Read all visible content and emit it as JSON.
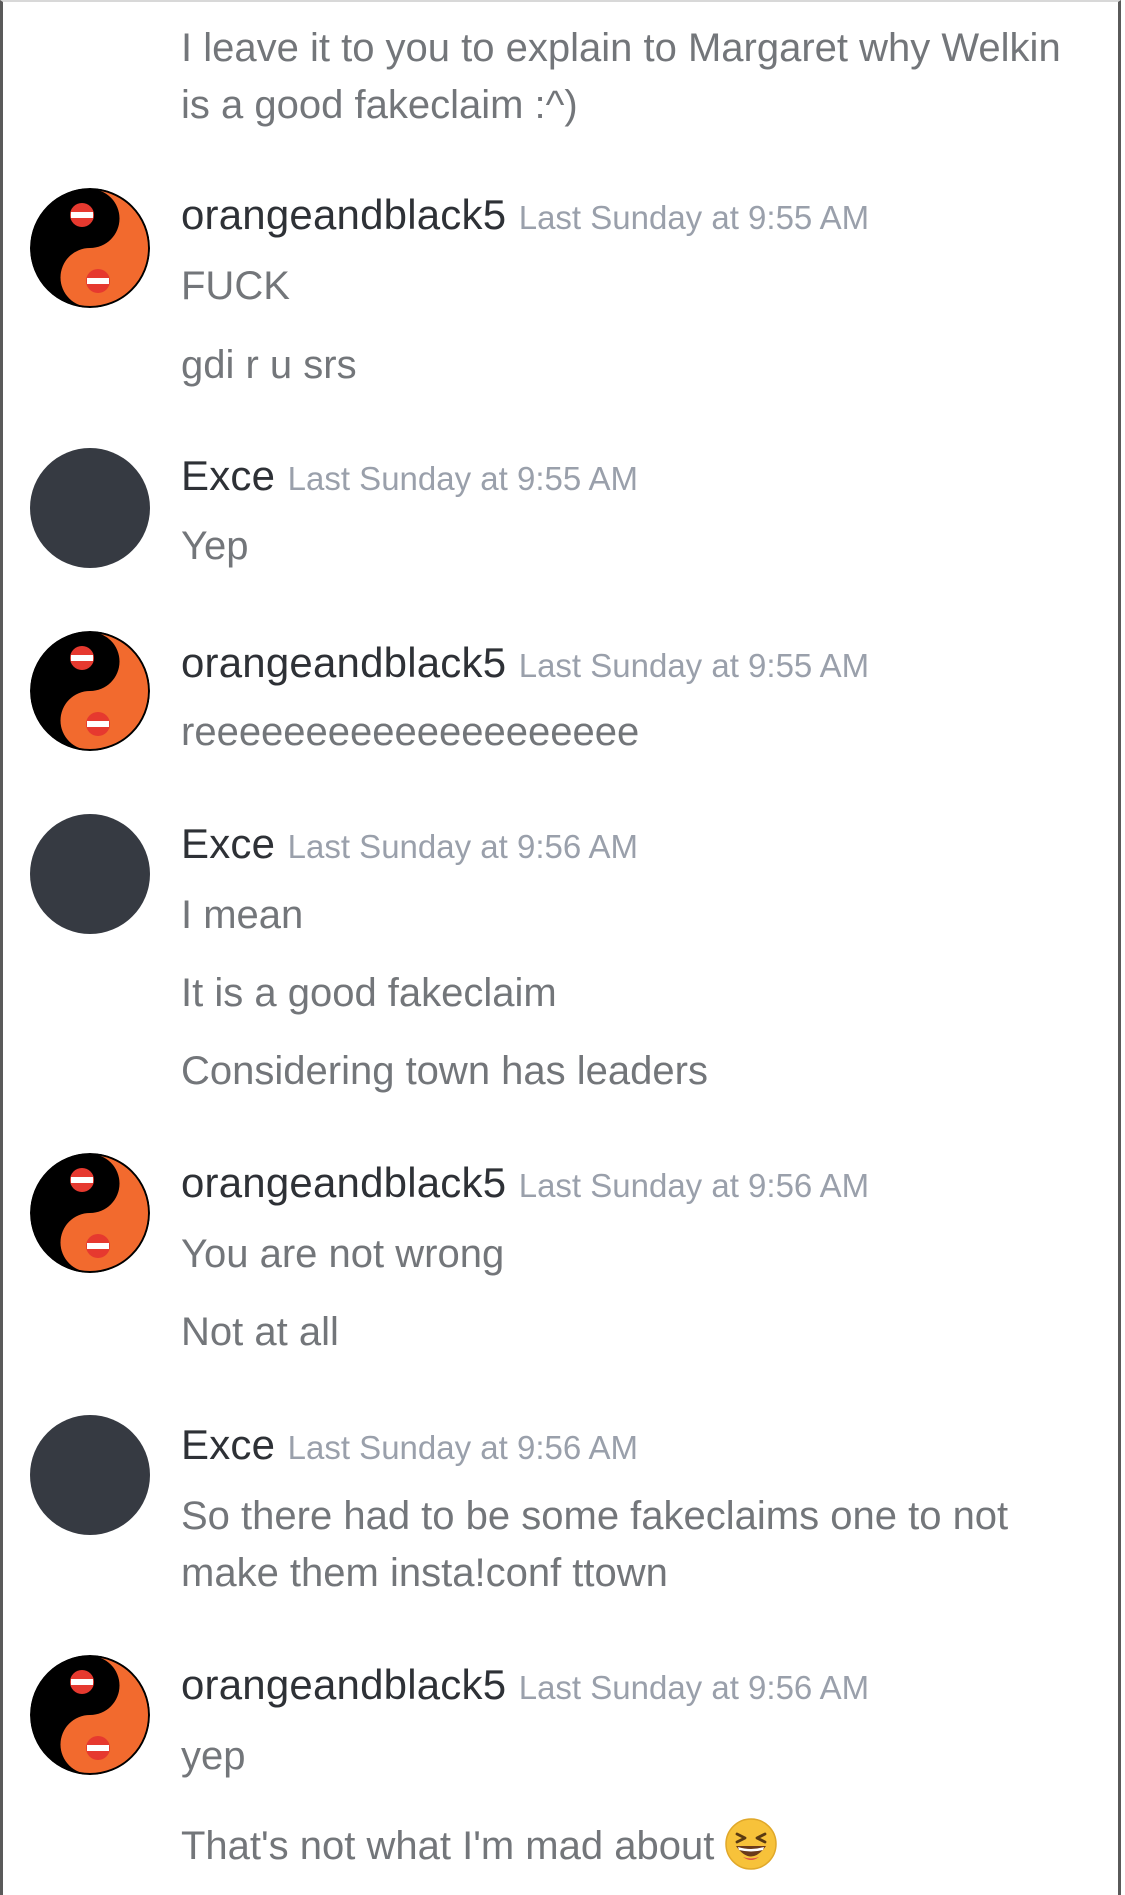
{
  "lead_message": "I leave it to you to explain to Margaret why Welkin is a good fakeclaim :^)",
  "messages": [
    {
      "user": "orangeandblack5",
      "time": "Last Sunday at 9:55 AM",
      "lines": [
        "FUCK",
        "gdi r u srs"
      ]
    },
    {
      "user": "Exce",
      "time": "Last Sunday at 9:55 AM",
      "lines": [
        "Yep"
      ]
    },
    {
      "user": "orangeandblack5",
      "time": "Last Sunday at 9:55 AM",
      "lines": [
        "reeeeeeeeeeeeeeeeeeee"
      ]
    },
    {
      "user": "Exce",
      "time": "Last Sunday at 9:56 AM",
      "lines": [
        "I mean",
        "It is a good fakeclaim",
        "Considering town has leaders"
      ]
    },
    {
      "user": "orangeandblack5",
      "time": "Last Sunday at 9:56 AM",
      "lines": [
        "You are not wrong",
        "Not at all"
      ]
    },
    {
      "user": "Exce",
      "time": "Last Sunday at 9:56 AM",
      "lines": [
        "So there had to be some fakeclaims one to not make them insta!conf ttown"
      ]
    },
    {
      "user": "orangeandblack5",
      "time": "Last Sunday at 9:56 AM",
      "lines": [
        "yep",
        "That's not what I'm mad about"
      ]
    }
  ],
  "icons": {
    "avatar_orange": "yin-yang-avatar-icon",
    "avatar_plain": "default-avatar-icon",
    "emoji": "laughing-emoji-icon"
  },
  "colors": {
    "username": "#2e3136",
    "timestamp": "#9aa0ab",
    "message": "#73767a",
    "avatar_plain": "#363a42",
    "avatar_orange": "#f26a2e"
  }
}
